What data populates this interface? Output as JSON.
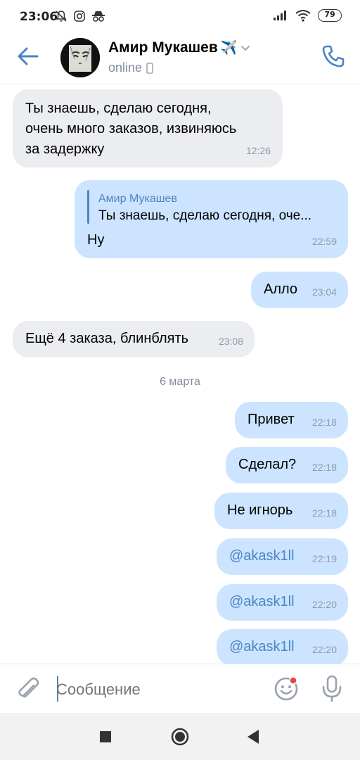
{
  "status_bar": {
    "time": "23:06",
    "battery": "79"
  },
  "header": {
    "contact_name": "Амир Мукашев",
    "name_emoji": "✈️",
    "status": "online"
  },
  "messages": [
    {
      "direction": "in",
      "lines": [
        "Ты знаешь, сделаю сегодня,",
        "очень много заказов, извиняюсь",
        "за задержку"
      ],
      "time": "12:26"
    },
    {
      "direction": "out",
      "reply_author": "Амир Мукашев",
      "reply_text": "Ты знаешь, сделаю сегодня, оче...",
      "text": "Ну",
      "time": "22:59"
    },
    {
      "direction": "out",
      "text": "Алло",
      "time": "23:04"
    },
    {
      "direction": "in",
      "text": "Ещё 4 заказа, блинблять",
      "time": "23:08"
    },
    {
      "direction": "out",
      "text": "Привет",
      "time": "22:18"
    },
    {
      "direction": "out",
      "text": "Сделал?",
      "time": "22:18"
    },
    {
      "direction": "out",
      "text": "Не игнорь",
      "time": "22:18"
    },
    {
      "direction": "out",
      "text": "@akask1ll",
      "time": "22:19"
    },
    {
      "direction": "out",
      "text": "@akask1ll",
      "time": "22:20"
    },
    {
      "direction": "out",
      "text": "@akask1ll",
      "time": "22:20"
    }
  ],
  "date_separator": "6 марта",
  "composer": {
    "placeholder": "Сообщение"
  },
  "colors": {
    "accent": "#4b84c3",
    "incoming_bubble": "#ebedf0",
    "outgoing_bubble": "#cce4ff",
    "notification_dot": "#e64646"
  }
}
